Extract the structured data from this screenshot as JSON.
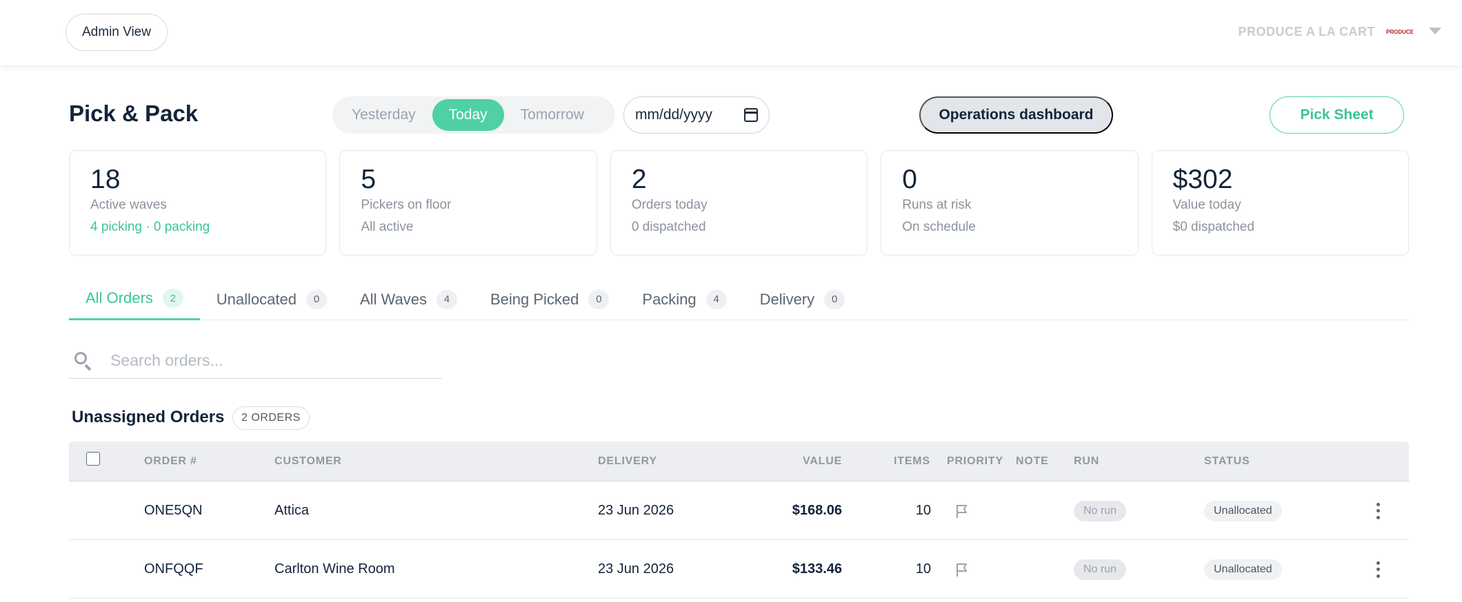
{
  "topbar": {
    "admin_view_label": "Admin View",
    "brand_name": "PRODUCE A LA CART",
    "logo_text": "PRODUCE"
  },
  "header": {
    "title": "Pick & Pack",
    "day_options": [
      "Yesterday",
      "Today",
      "Tomorrow"
    ],
    "selected_day": "Today",
    "date_placeholder": "mm/dd/yyyy",
    "ops_dashboard_label": "Operations dashboard",
    "pick_sheet_label": "Pick Sheet"
  },
  "stats": [
    {
      "value": "18",
      "label": "Active waves",
      "sub": "4 picking · 0 packing",
      "sub_color": "#3cc495"
    },
    {
      "value": "5",
      "label": "Pickers on floor",
      "sub": "All active"
    },
    {
      "value": "2",
      "label": "Orders today",
      "sub": "0 dispatched"
    },
    {
      "value": "0",
      "label": "Runs at risk",
      "sub": "On schedule"
    },
    {
      "value": "$302",
      "label": "Value today",
      "sub": "$0 dispatched"
    }
  ],
  "tabs": [
    {
      "label": "All Orders",
      "count": "2",
      "active": true
    },
    {
      "label": "Unallocated",
      "count": "0"
    },
    {
      "label": "All Waves",
      "count": "4"
    },
    {
      "label": "Being Picked",
      "count": "0"
    },
    {
      "label": "Packing",
      "count": "4"
    },
    {
      "label": "Delivery",
      "count": "0"
    }
  ],
  "search": {
    "placeholder": "Search orders..."
  },
  "section": {
    "title": "Unassigned Orders",
    "badge": "2 ORDERS"
  },
  "table": {
    "columns": [
      "ORDER #",
      "CUSTOMER",
      "DELIVERY",
      "VALUE",
      "ITEMS",
      "PRIORITY",
      "NOTE",
      "RUN",
      "STATUS"
    ],
    "rows": [
      {
        "order": "ONE5QN",
        "customer": "Attica",
        "delivery": "23 Jun 2026",
        "value": "$168.06",
        "items": "10",
        "run": "No run",
        "status": "Unallocated"
      },
      {
        "order": "ONFQQF",
        "customer": "Carlton Wine Room",
        "delivery": "23 Jun 2026",
        "value": "$133.46",
        "items": "10",
        "run": "No run",
        "status": "Unallocated"
      }
    ]
  },
  "colors": {
    "accent": "#4fd1a5",
    "accent_text": "#3cc495",
    "title": "#13233a",
    "muted": "#8a939d"
  },
  "icons": {
    "search": "search-icon",
    "flag": "flag-icon",
    "more": "more-vertical-icon",
    "calendar": "calendar-icon",
    "caret": "chevron-down-icon"
  }
}
